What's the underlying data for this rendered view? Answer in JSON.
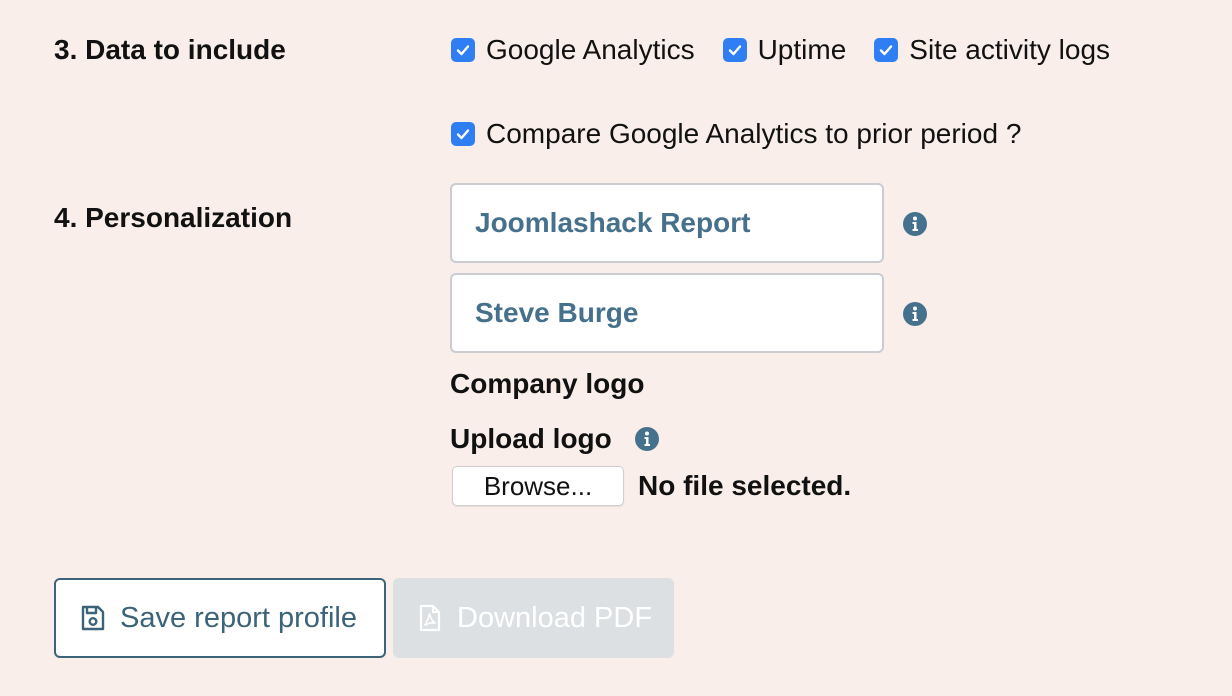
{
  "data_section": {
    "label": "3. Data to include",
    "options": [
      {
        "label": "Google Analytics",
        "checked": true
      },
      {
        "label": "Uptime",
        "checked": true
      },
      {
        "label": "Site activity logs",
        "checked": true
      }
    ],
    "compare": {
      "label": "Compare Google Analytics to prior period ?",
      "checked": true
    }
  },
  "personalization": {
    "label": "4. Personalization",
    "report_title_value": "Joomlashack Report",
    "author_value": "Steve Burge",
    "company_logo_label": "Company logo",
    "upload_logo_label": "Upload logo",
    "browse_label": "Browse...",
    "file_status": "No file selected."
  },
  "actions": {
    "save_label": "Save report profile",
    "download_label": "Download PDF"
  },
  "colors": {
    "background": "#f9eee9",
    "checkbox": "#2f7ef3",
    "accent": "#3d6378",
    "input_text": "#46718c",
    "disabled_button": "#dde0e2"
  },
  "icons": {
    "checkbox": "check-icon",
    "info": "info-circle-icon",
    "save": "floppy-disk-icon",
    "download": "pdf-file-icon"
  }
}
